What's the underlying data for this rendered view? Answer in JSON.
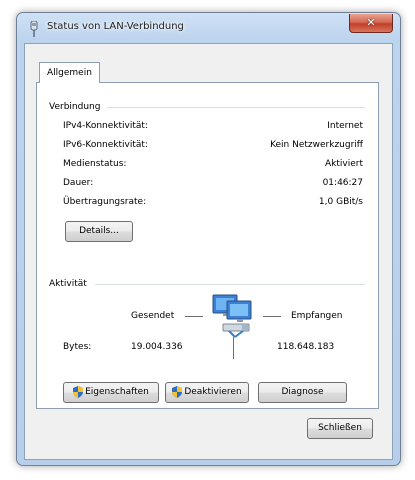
{
  "window": {
    "title": "Status von LAN-Verbindung",
    "close_label": "✕"
  },
  "tabs": [
    {
      "label": "Allgemein",
      "selected": true
    }
  ],
  "connection": {
    "title": "Verbindung",
    "rows": [
      {
        "label": "IPv4-Konnektivität:",
        "value": "Internet"
      },
      {
        "label": "IPv6-Konnektivität:",
        "value": "Kein Netzwerkzugriff"
      },
      {
        "label": "Medienstatus:",
        "value": "Aktiviert"
      },
      {
        "label": "Dauer:",
        "value": "01:46:27"
      },
      {
        "label": "Übertragungsrate:",
        "value": "1,0 GBit/s"
      }
    ],
    "details_button": "Details..."
  },
  "activity": {
    "title": "Aktivität",
    "sent_label": "Gesendet",
    "received_label": "Empfangen",
    "bytes_label": "Bytes:",
    "bytes_sent": "19.004.336",
    "bytes_received": "118.648.183"
  },
  "actions": {
    "properties": "Eigenschaften",
    "disable": "Deaktivieren",
    "diagnose": "Diagnose"
  },
  "footer": {
    "close_button": "Schließen"
  },
  "colors": {
    "titlebar": "#b7cfea",
    "close_red": "#c0402a",
    "panel_bg": "#ffffff",
    "client_bg": "#f0f0f0",
    "group_line": "#d5dfe5"
  },
  "icons": {
    "title": "network-plug-icon",
    "activity": "network-computers-icon",
    "shield": "uac-shield-icon"
  }
}
